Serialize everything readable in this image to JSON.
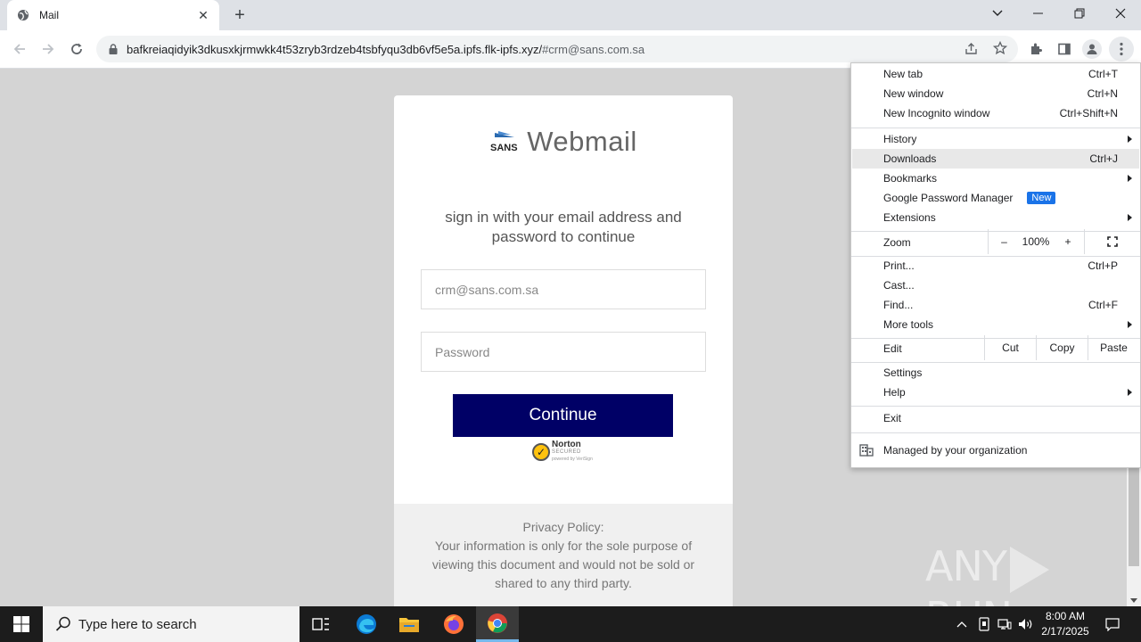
{
  "browser": {
    "tab_title": "Mail",
    "url_host": "bafkreiaqidyik3dkusxkjrmwkk4t53zryb3rdzeb4tsbfyqu3db6vf5e5a.ipfs.flk-ipfs.xyz/",
    "url_fragment": "#crm@sans.com.sa"
  },
  "page": {
    "brand_name": "Webmail",
    "logo_text": "SANS",
    "signin_text": "sign in with your email address and password to continue",
    "email_value": "crm@sans.com.sa",
    "password_placeholder": "Password",
    "continue_label": "Continue",
    "norton": {
      "line1": "Norton",
      "line2": "SECURED",
      "line3": "powered by VeriSign"
    },
    "privacy_title": "Privacy Policy:",
    "privacy_text": "Your information is only for the sole purpose of viewing this document and would not be sold or shared to any third party."
  },
  "watermark": {
    "left": "ANY",
    "right": "RUN"
  },
  "menu": {
    "new_tab": {
      "label": "New tab",
      "shortcut": "Ctrl+T"
    },
    "new_window": {
      "label": "New window",
      "shortcut": "Ctrl+N"
    },
    "new_incognito": {
      "label": "New Incognito window",
      "shortcut": "Ctrl+Shift+N"
    },
    "history": {
      "label": "History"
    },
    "downloads": {
      "label": "Downloads",
      "shortcut": "Ctrl+J"
    },
    "bookmarks": {
      "label": "Bookmarks"
    },
    "password_manager": {
      "label": "Google Password Manager",
      "badge": "New"
    },
    "extensions": {
      "label": "Extensions"
    },
    "zoom": {
      "label": "Zoom",
      "minus": "–",
      "level": "100%",
      "plus": "+"
    },
    "print": {
      "label": "Print...",
      "shortcut": "Ctrl+P"
    },
    "cast": {
      "label": "Cast..."
    },
    "find": {
      "label": "Find...",
      "shortcut": "Ctrl+F"
    },
    "more_tools": {
      "label": "More tools"
    },
    "edit": {
      "label": "Edit",
      "cut": "Cut",
      "copy": "Copy",
      "paste": "Paste"
    },
    "settings": {
      "label": "Settings"
    },
    "help": {
      "label": "Help"
    },
    "exit": {
      "label": "Exit"
    },
    "managed": {
      "label": "Managed by your organization"
    }
  },
  "taskbar": {
    "search_placeholder": "Type here to search",
    "time": "8:00 AM",
    "date": "2/17/2025"
  },
  "colors": {
    "continue_button": "#000066",
    "badge_blue": "#1a73e8",
    "page_background": "#d4d4d4"
  }
}
